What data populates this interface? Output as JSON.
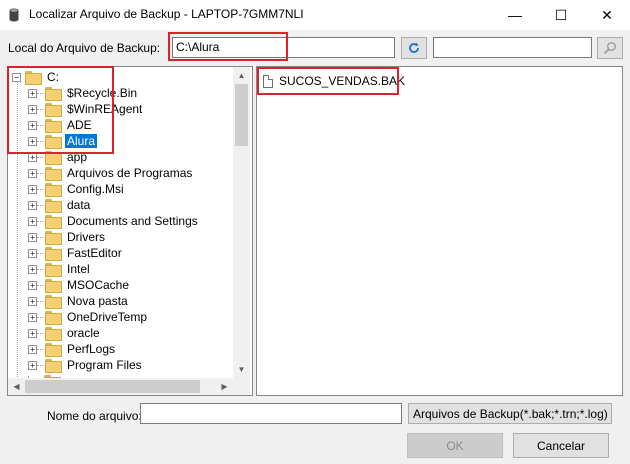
{
  "window": {
    "title": "Localizar Arquivo de Backup - LAPTOP-7GMM7NLI",
    "minimize_glyph": "—",
    "maximize_glyph": "☐",
    "close_glyph": "✕"
  },
  "location": {
    "label": "Local do Arquivo de Backup:",
    "value": "C:\\Alura",
    "search_value": ""
  },
  "tree": {
    "root": "C:",
    "items": [
      {
        "label": "$Recycle.Bin",
        "selected": false
      },
      {
        "label": "$WinREAgent",
        "selected": false
      },
      {
        "label": "ADE",
        "selected": false
      },
      {
        "label": "Alura",
        "selected": true
      },
      {
        "label": "app",
        "selected": false
      },
      {
        "label": "Arquivos de Programas",
        "selected": false
      },
      {
        "label": "Config.Msi",
        "selected": false
      },
      {
        "label": "data",
        "selected": false
      },
      {
        "label": "Documents and Settings",
        "selected": false
      },
      {
        "label": "Drivers",
        "selected": false
      },
      {
        "label": "FastEditor",
        "selected": false
      },
      {
        "label": "Intel",
        "selected": false
      },
      {
        "label": "MSOCache",
        "selected": false
      },
      {
        "label": "Nova pasta",
        "selected": false
      },
      {
        "label": "OneDriveTemp",
        "selected": false
      },
      {
        "label": "oracle",
        "selected": false
      },
      {
        "label": "PerfLogs",
        "selected": false
      },
      {
        "label": "Program Files",
        "selected": false
      }
    ]
  },
  "files": [
    {
      "name": "SUCOS_VENDAS.BAK",
      "icon": "file-icon"
    }
  ],
  "bottom": {
    "filename_label": "Nome do arquivo:",
    "filename_value": "",
    "filetype": "Arquivos de Backup(*.bak;*.trn;*.log)",
    "ok_label": "OK",
    "cancel_label": "Cancelar"
  },
  "colors": {
    "highlight": "#d9232d",
    "selection": "#0078d7",
    "folder": "#f5cf74"
  }
}
